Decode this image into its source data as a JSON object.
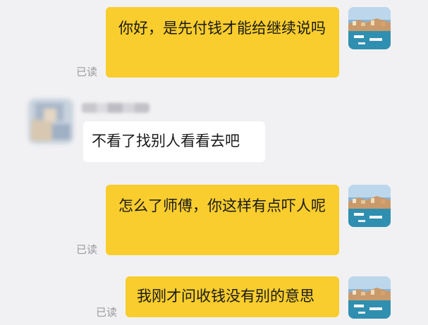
{
  "messages": [
    {
      "sender": "self",
      "text": "你好，是先付钱才能给继续说吗",
      "status": "已读"
    },
    {
      "sender": "other",
      "sender_name_blurred": true,
      "text": "不看了找别人看看去吧"
    },
    {
      "sender": "self",
      "text": "怎么了师傅，你这样有点吓人呢",
      "status": "已读"
    },
    {
      "sender": "self",
      "text": "我刚才问收钱没有别的意思",
      "status": "已读"
    }
  ],
  "colors": {
    "background": "#f1f1f3",
    "self_bubble": "#f8cd2d",
    "other_bubble": "#ffffff",
    "read_status": "#9a9a9f"
  },
  "icons": {
    "self_avatar": "harbor-photo-avatar-icon",
    "other_avatar": "blurred-avatar-icon"
  }
}
